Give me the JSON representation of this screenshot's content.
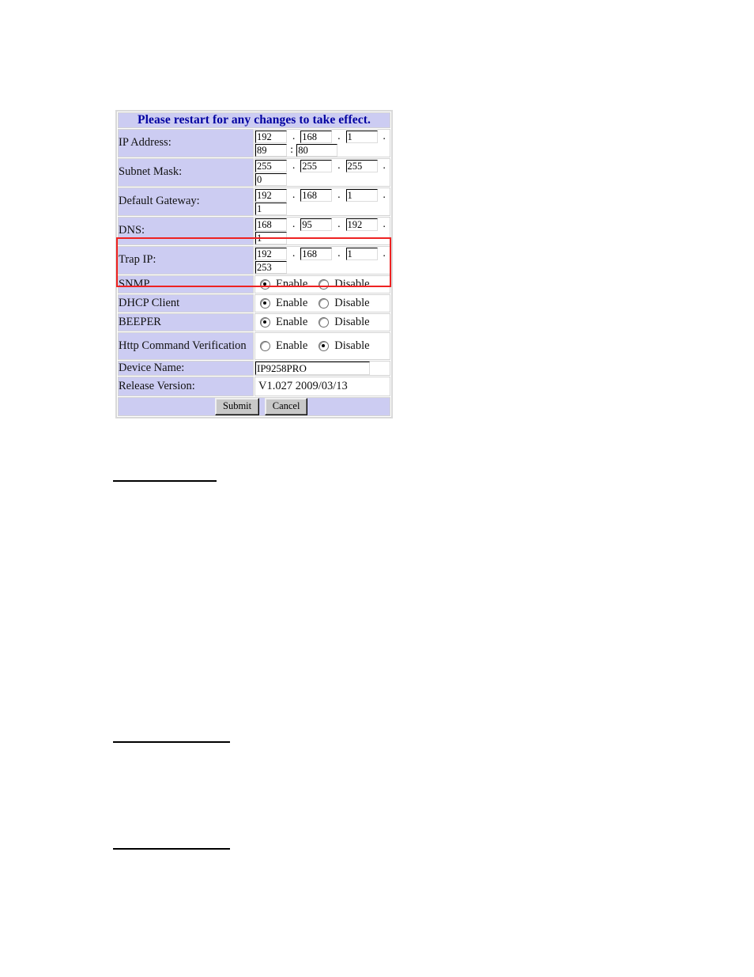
{
  "panel": {
    "banner": "Please restart for any changes to take effect.",
    "rows": {
      "ip_address": {
        "label": "IP Address:",
        "octets": [
          "192",
          "168",
          "1",
          "89"
        ],
        "port": "80",
        "separator": ".",
        "port_separator": ":"
      },
      "subnet_mask": {
        "label": "Subnet Mask:",
        "octets": [
          "255",
          "255",
          "255",
          "0"
        ]
      },
      "default_gateway": {
        "label": "Default Gateway:",
        "octets": [
          "192",
          "168",
          "1",
          "1"
        ]
      },
      "dns": {
        "label": "DNS:",
        "octets": [
          "168",
          "95",
          "192",
          "1"
        ]
      },
      "trap_ip": {
        "label": "Trap IP:",
        "octets": [
          "192",
          "168",
          "1",
          "253"
        ]
      },
      "snmp": {
        "label": "SNMP",
        "enable_label": "Enable",
        "disable_label": "Disable",
        "selected": "Enable"
      },
      "dhcp_client": {
        "label": "DHCP Client",
        "enable_label": "Enable",
        "disable_label": "Disable",
        "selected": "Enable"
      },
      "beeper": {
        "label": "BEEPER",
        "enable_label": "Enable",
        "disable_label": "Disable",
        "selected": "Enable"
      },
      "http_command_verification": {
        "label": "Http Command Verification",
        "enable_label": "Enable",
        "disable_label": "Disable",
        "selected": "Disable"
      },
      "device_name": {
        "label": "Device Name:",
        "value": "IP9258PRO"
      },
      "release_version": {
        "label": "Release Version:",
        "value": "V1.027 2009/03/13"
      }
    },
    "buttons": {
      "submit": "Submit",
      "cancel": "Cancel"
    }
  },
  "colors": {
    "label_background": "#ccccf2",
    "banner_text": "#0000a0",
    "annotation_border": "#ee2222",
    "button_face": "#c8c8c8"
  }
}
